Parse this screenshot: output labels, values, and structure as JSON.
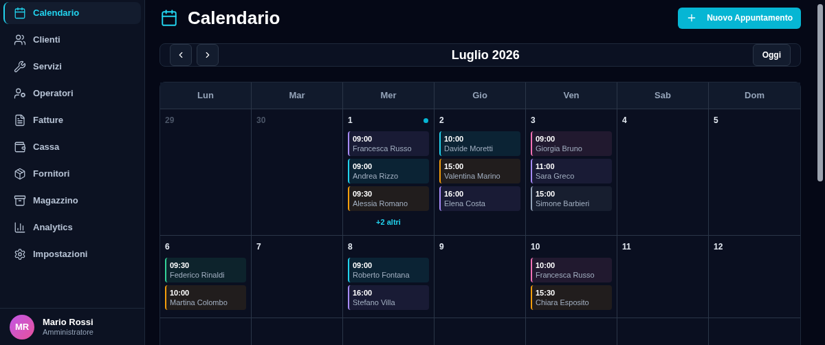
{
  "sidebar": {
    "items": [
      {
        "label": "Calendario",
        "selected": true
      },
      {
        "label": "Clienti",
        "selected": false
      },
      {
        "label": "Servizi",
        "selected": false
      },
      {
        "label": "Operatori",
        "selected": false
      },
      {
        "label": "Fatture",
        "selected": false
      },
      {
        "label": "Cassa",
        "selected": false
      },
      {
        "label": "Fornitori",
        "selected": false
      },
      {
        "label": "Magazzino",
        "selected": false
      },
      {
        "label": "Analytics",
        "selected": false
      },
      {
        "label": "Impostazioni",
        "selected": false
      }
    ],
    "user": {
      "initials": "MR",
      "name": "Mario Rossi",
      "role": "Amministratore"
    }
  },
  "header": {
    "title": "Calendario",
    "new_button": "Nuovo Appuntamento"
  },
  "calendar": {
    "month": "Luglio 2026",
    "today_button": "Oggi",
    "weekdays": [
      "Lun",
      "Mar",
      "Mer",
      "Gio",
      "Ven",
      "Sab",
      "Dom"
    ],
    "weeks": [
      [
        {
          "day": "29",
          "outside": true,
          "today": false
        },
        {
          "day": "30",
          "outside": true,
          "today": false
        },
        {
          "day": "1",
          "outside": false,
          "today": true,
          "more": "+2 altri",
          "events": [
            {
              "time": "09:00",
              "name": "Francesca Russo",
              "color": "#a78bfa"
            },
            {
              "time": "09:00",
              "name": "Andrea Rizzo",
              "color": "#22d3ee"
            },
            {
              "time": "09:30",
              "name": "Alessia Romano",
              "color": "#f59e0b"
            }
          ]
        },
        {
          "day": "2",
          "outside": false,
          "today": false,
          "events": [
            {
              "time": "10:00",
              "name": "Davide Moretti",
              "color": "#22d3ee"
            },
            {
              "time": "15:00",
              "name": "Valentina Marino",
              "color": "#f59e0b"
            },
            {
              "time": "16:00",
              "name": "Elena Costa",
              "color": "#a78bfa"
            }
          ]
        },
        {
          "day": "3",
          "outside": false,
          "today": false,
          "events": [
            {
              "time": "09:00",
              "name": "Giorgia Bruno",
              "color": "#f472b6"
            },
            {
              "time": "11:00",
              "name": "Sara Greco",
              "color": "#a78bfa"
            },
            {
              "time": "15:00",
              "name": "Simone Barbieri",
              "color": "#94a3b8"
            }
          ]
        },
        {
          "day": "4",
          "outside": false,
          "today": false
        },
        {
          "day": "5",
          "outside": false,
          "today": false
        }
      ],
      [
        {
          "day": "6",
          "outside": false,
          "today": false,
          "events": [
            {
              "time": "09:30",
              "name": "Federico Rinaldi",
              "color": "#34d399"
            },
            {
              "time": "10:00",
              "name": "Martina Colombo",
              "color": "#f59e0b"
            }
          ]
        },
        {
          "day": "7",
          "outside": false,
          "today": false
        },
        {
          "day": "8",
          "outside": false,
          "today": false,
          "events": [
            {
              "time": "09:00",
              "name": "Roberto Fontana",
              "color": "#22d3ee"
            },
            {
              "time": "16:00",
              "name": "Stefano Villa",
              "color": "#a78bfa"
            }
          ]
        },
        {
          "day": "9",
          "outside": false,
          "today": false
        },
        {
          "day": "10",
          "outside": false,
          "today": false,
          "events": [
            {
              "time": "10:00",
              "name": "Francesca Russo",
              "color": "#f472b6"
            },
            {
              "time": "15:30",
              "name": "Chiara Esposito",
              "color": "#f59e0b"
            }
          ]
        },
        {
          "day": "11",
          "outside": false,
          "today": false
        },
        {
          "day": "12",
          "outside": false,
          "today": false
        }
      ]
    ]
  }
}
